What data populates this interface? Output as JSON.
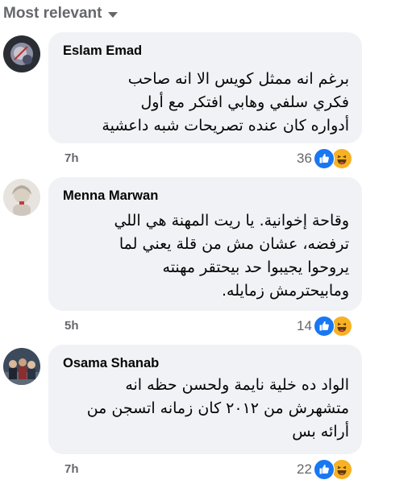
{
  "sort": {
    "label": "Most relevant",
    "icon": "chevron-down-icon"
  },
  "comments": [
    {
      "author": "Eslam Emad",
      "lines": [
        "برغم انه ممثل كويس الا انه صاحب",
        "فكري سلفي وهابي افتكر مع أول",
        "أدواره كان عنده تصريحات شبه داعشية"
      ],
      "time": "7h",
      "reaction_count": "36",
      "reactions": [
        "like-icon",
        "haha-icon"
      ]
    },
    {
      "author": "Menna Marwan",
      "lines": [
        "وقاحة إخوانية. يا ريت المهنة هي اللي",
        "ترفضه، عشان مش من قلة يعني لما",
        "يروحوا يجيبوا حد بيحتقر مهنته",
        "ومابيحترمش زمايله."
      ],
      "time": "5h",
      "reaction_count": "14",
      "reactions": [
        "like-icon",
        "haha-icon"
      ]
    },
    {
      "author": "Osama Shanab",
      "lines": [
        "الواد ده خلية نايمة ولحسن حظه انه",
        "متشهرش من ٢٠١٢ كان زمانه اتسجن من",
        "أرائه بس"
      ],
      "time": "7h",
      "reaction_count": "22",
      "reactions": [
        "like-icon",
        "haha-icon"
      ]
    }
  ],
  "colors": {
    "like": "#1877f2",
    "haha": "#f7b125",
    "bubble": "#f0f2f5",
    "secondary_text": "#65676b"
  }
}
